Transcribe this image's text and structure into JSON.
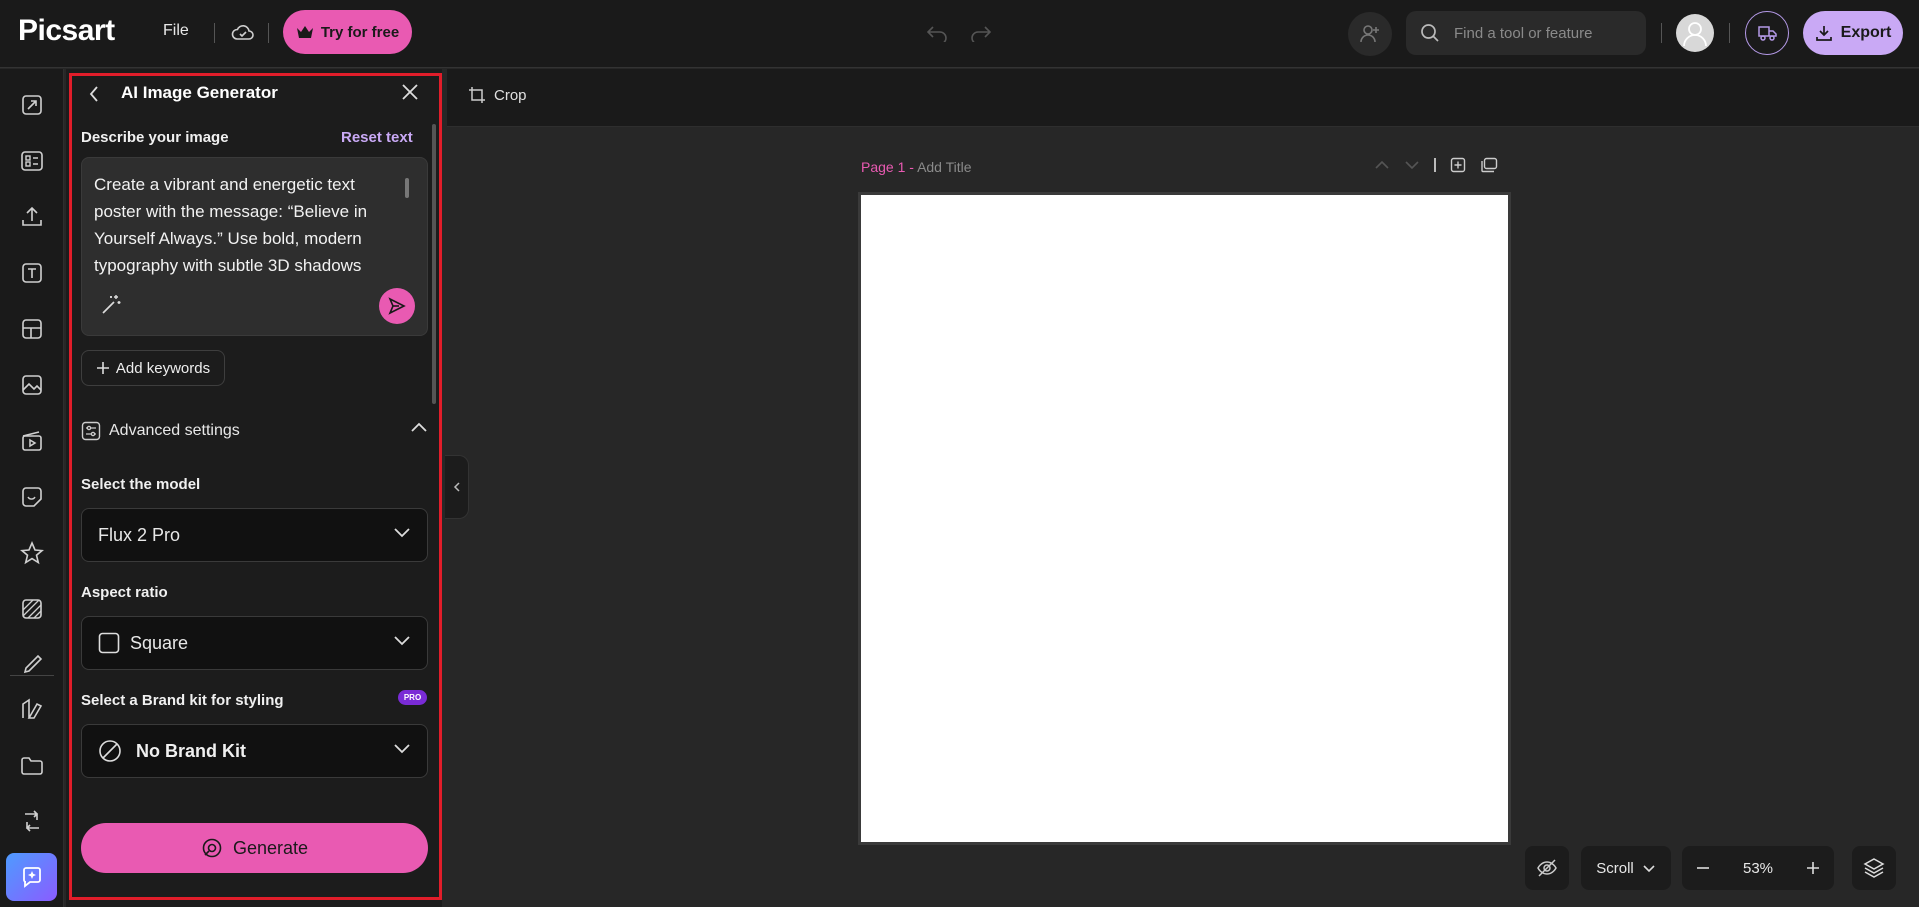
{
  "topbar": {
    "logo": "Picsart",
    "file_label": "File",
    "try_label": "Try for free",
    "search_placeholder": "Find a tool or feature",
    "export_label": "Export"
  },
  "panel": {
    "title": "AI Image Generator",
    "describe_label": "Describe your image",
    "reset_label": "Reset text",
    "prompt_text": "Create a vibrant and energetic text poster with the message: “Believe in Yourself Always.” Use bold, modern typography with subtle 3D shadows",
    "add_keywords_label": "Add keywords",
    "advanced_label": "Advanced settings",
    "model_label": "Select the model",
    "model_value": "Flux 2 Pro",
    "aspect_label": "Aspect ratio",
    "aspect_value": "Square",
    "brand_label": "Select a Brand kit for styling",
    "pro_badge": "PRO",
    "brand_value": "No Brand Kit",
    "generate_label": "Generate"
  },
  "canvas": {
    "crop_label": "Crop",
    "page_number": "Page 1 -",
    "page_title_placeholder": "Add Title"
  },
  "bottom": {
    "scroll_label": "Scroll",
    "zoom_value": "53%"
  },
  "colors": {
    "accent_pink": "#e95ab2",
    "accent_purple": "#c9a9f5",
    "highlight_red": "#e11d2a"
  }
}
